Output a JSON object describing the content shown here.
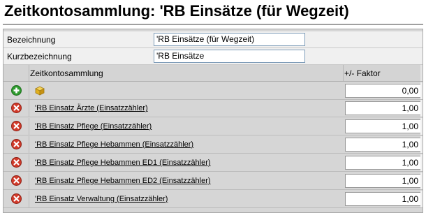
{
  "page": {
    "title": "Zeitkontosammlung: 'RB Einsätze (für Wegzeit)"
  },
  "form": {
    "bezeichnung": {
      "label": "Bezeichnung",
      "value": "'RB Einsätze (für Wegzeit)"
    },
    "kurzbezeichnung": {
      "label": "Kurzbezeichnung",
      "value": "'RB Einsätze"
    }
  },
  "grid": {
    "col_account": "Zeitkontosammlung",
    "col_factor": "+/- Faktor",
    "add_row": {
      "factor": "0,00",
      "icons": [
        "add-icon",
        "cube-icon"
      ]
    },
    "rows": [
      {
        "name": "'RB Einsatz Ärzte (Einsatzzähler)",
        "factor": "1,00"
      },
      {
        "name": "'RB Einsatz Pflege (Einsatzzähler)",
        "factor": "1,00"
      },
      {
        "name": "'RB Einsatz Pflege Hebammen (Einsatzzähler)",
        "factor": "1,00"
      },
      {
        "name": "'RB Einsatz Pflege Hebammen ED1 (Einsatzzähler)",
        "factor": "1,00"
      },
      {
        "name": "'RB Einsatz Pflege Hebammen ED2 (Einsatzzähler)",
        "factor": "1,00"
      },
      {
        "name": "'RB Einsatz Verwaltung (Einsatzzähler)",
        "factor": "1,00"
      }
    ],
    "row_icon": "remove-icon"
  },
  "colors": {
    "add": "#2e9b2e",
    "remove": "#d23a2a",
    "cube": "#e0b020"
  }
}
